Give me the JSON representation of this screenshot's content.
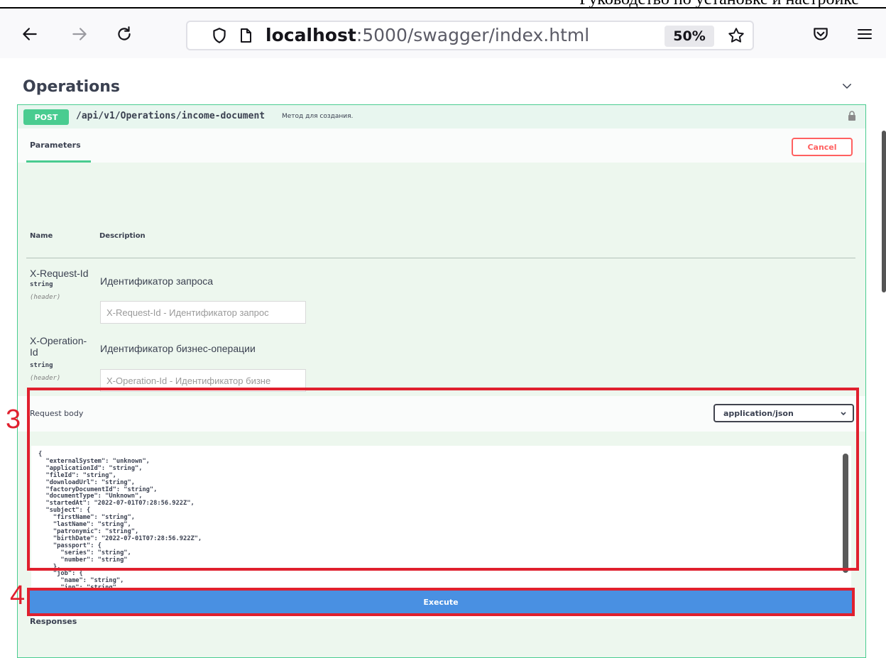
{
  "document": {
    "title": "Руководство по установке и настройке"
  },
  "browser": {
    "url_host": "localhost",
    "url_rest": ":5000/swagger/index.html",
    "zoom": "50%"
  },
  "operations": {
    "title": "Operations",
    "method": "POST",
    "path": "/api/v1/Operations/income-document",
    "path_description": "Метод для создания.",
    "params_tab": "Parameters",
    "cancel_label": "Cancel",
    "col_name": "Name",
    "col_description": "Description",
    "params": [
      {
        "name": "X-Request-Id",
        "type": "string",
        "in": "(header)",
        "description": "Идентификатор запроса",
        "placeholder": "X-Request-Id - Идентификатор запрос"
      },
      {
        "name_line1": "X-Operation-",
        "name_line2": "Id",
        "type": "string",
        "in": "(header)",
        "description": "Идентификатор бизнес-операции",
        "placeholder": "X-Operation-Id - Идентификатор бизне"
      }
    ],
    "request_body_label": "Request body",
    "content_type": "application/json",
    "body_json": "{\n  \"externalSystem\": \"unknown\",\n  \"applicationId\": \"string\",\n  \"fileId\": \"string\",\n  \"downloadUrl\": \"string\",\n  \"factoryDocumentId\": \"string\",\n  \"documentType\": \"Unknown\",\n  \"startedAt\": \"2022-07-01T07:28:56.922Z\",\n  \"subject\": {\n    \"firstName\": \"string\",\n    \"lastName\": \"string\",\n    \"patronymic\": \"string\",\n    \"birthDate\": \"2022-07-01T07:28:56.922Z\",\n    \"passport\": {\n      \"series\": \"string\",\n      \"number\": \"string\"\n    },\n    \"job\": {\n      \"name\": \"string\",\n      \"inn\": \"string\"",
    "execute_label": "Execute",
    "responses_label": "Responses"
  },
  "annotations": {
    "step3": "3",
    "step4": "4",
    "color": "#e0202e"
  },
  "colors": {
    "post_green": "#49cc90",
    "execute_blue": "#4990e2",
    "cancel_red": "#ff6060"
  }
}
